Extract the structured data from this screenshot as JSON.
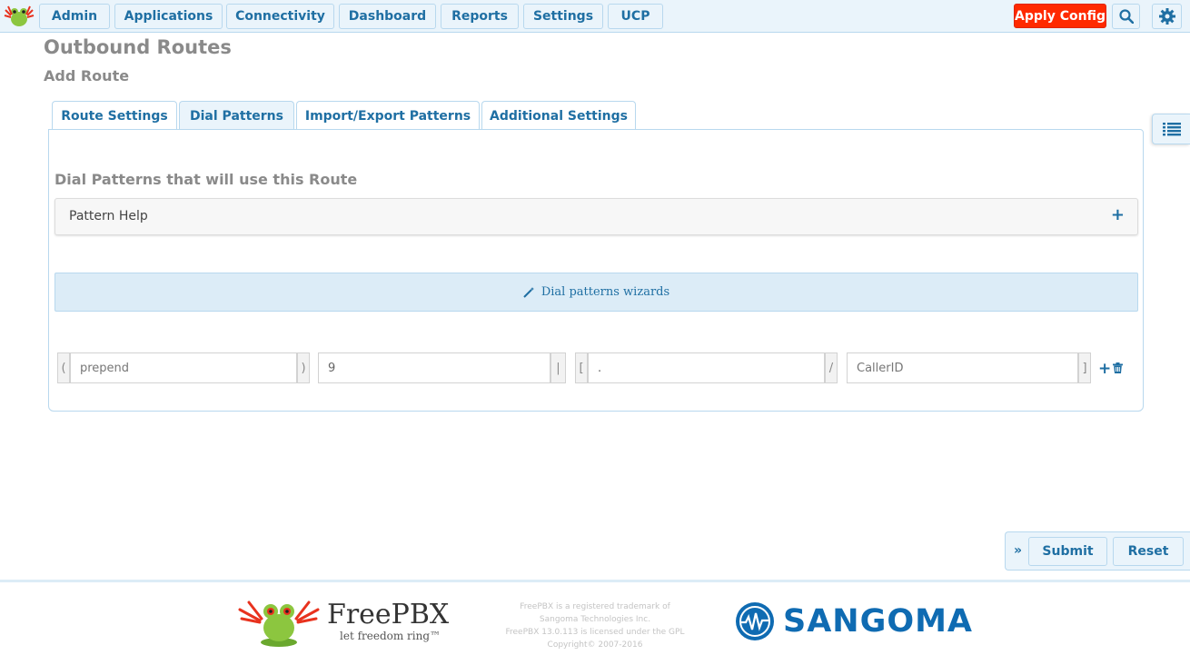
{
  "nav": {
    "items": [
      "Admin",
      "Applications",
      "Connectivity",
      "Dashboard",
      "Reports",
      "Settings",
      "UCP"
    ],
    "apply_config": "Apply Config",
    "search_icon": "search-icon",
    "settings_icon": "gear-icon"
  },
  "page": {
    "title": "Outbound Routes",
    "subtitle": "Add Route"
  },
  "tabs": [
    {
      "label": "Route Settings",
      "active": false
    },
    {
      "label": "Dial Patterns",
      "active": true
    },
    {
      "label": "Import/Export Patterns",
      "active": false
    },
    {
      "label": "Additional Settings",
      "active": false
    }
  ],
  "dial_patterns": {
    "heading": "Dial Patterns that will use this Route",
    "pattern_help": "Pattern Help",
    "pattern_help_toggle": "+",
    "wizard": "Dial patterns wizards",
    "row": {
      "open_paren": "(",
      "prepend_placeholder": "prepend",
      "close_paren": ")",
      "prefix_value": "9",
      "pipe": "|",
      "open_bracket": "[",
      "match_value": ".",
      "slash": "/",
      "callerid_placeholder": "CallerID",
      "close_bracket": "]",
      "add": "+"
    }
  },
  "actions": {
    "submit": "Submit",
    "reset": "Reset",
    "collapse": "»"
  },
  "footer": {
    "freepbx_name": "FreePBX",
    "freepbx_tagline": "let freedom ring™",
    "legal_lines": [
      "FreePBX is a registered trademark of",
      "Sangoma Technologies Inc.",
      "FreePBX 13.0.113 is licensed under the GPL",
      "Copyright© 2007-2016"
    ],
    "sangoma_name": "SANGOMA"
  },
  "colors": {
    "accent": "#1f6fa3",
    "apply": "#ff2a00",
    "nav_bg": "#eaf4fb"
  }
}
